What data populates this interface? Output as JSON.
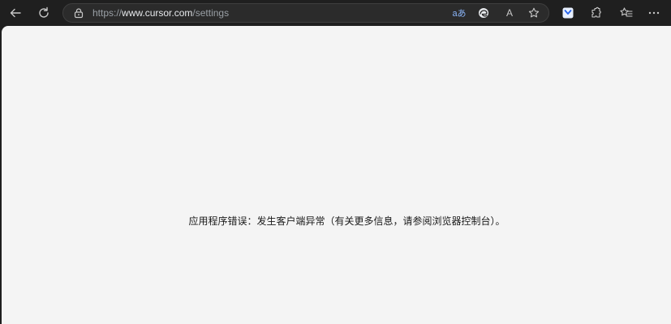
{
  "browser": {
    "toolbar": {
      "url_scheme": "https://",
      "url_host": "www.cursor.com",
      "url_path": "/settings",
      "read_aloud_label": "A",
      "translate_label": "aあ"
    },
    "icons": {
      "back": "back-arrow-icon",
      "reload": "reload-icon",
      "lock": "lock-icon",
      "translate": "translate-icon",
      "edge": "edge-icon",
      "read_aloud": "read-aloud-icon",
      "favorite": "star-icon",
      "extension_blue": "extension-icon",
      "extensions": "puzzle-icon",
      "favorites": "favorites-icon",
      "more": "more-icon"
    }
  },
  "page": {
    "error_message": "应用程序错误：发生客户端异常（有关更多信息，请参阅浏览器控制台）。"
  },
  "colors": {
    "toolbar_bg": "#1f1f1f",
    "page_bg": "#f4f4f4",
    "text": "#1a1a1a"
  }
}
